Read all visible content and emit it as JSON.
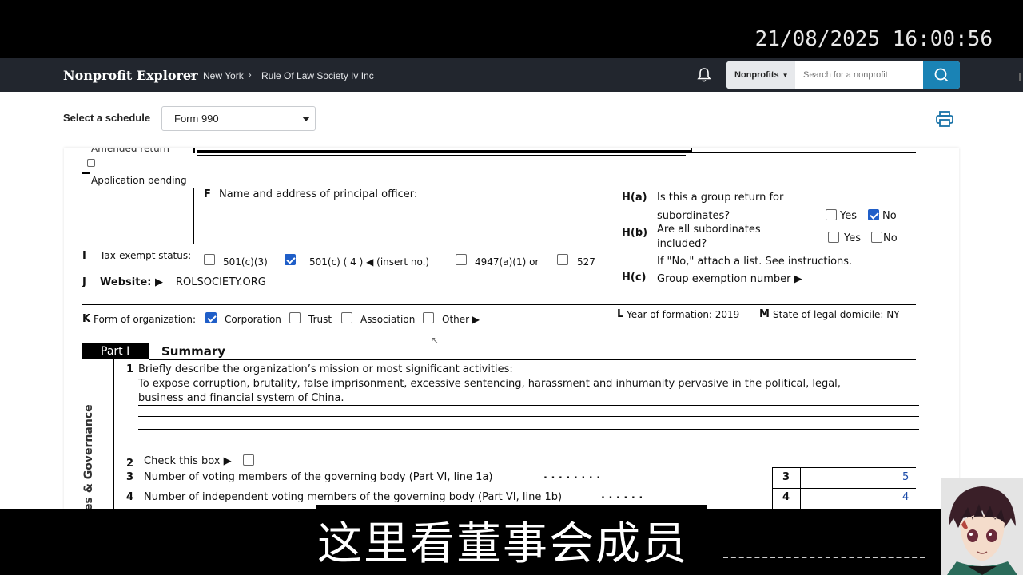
{
  "overlay": {
    "timestamp": "21/08/2025 16:00:56",
    "subtitle": "这里看董事会成员"
  },
  "nav": {
    "brand": "Nonprofit Explorer",
    "breadcrumbs": [
      "New York",
      "Rule Of Law Society Iv Inc"
    ],
    "search_category": "Nonprofits",
    "search_placeholder": "Search for a nonprofit"
  },
  "toolbar": {
    "schedule_label": "Select a schedule",
    "schedule_value": "Form 990"
  },
  "form": {
    "amended_label": "Amended return",
    "app_pending_label": "Application pending",
    "f_letter": "F",
    "f_label": "Name and address of principal officer:",
    "ha_code": "H(a)",
    "ha_q1": "Is this a group return for",
    "ha_q2": "subordinates?",
    "hb_code": "H(b)",
    "hb_q1": "Are all subordinates",
    "hb_q2": "included?",
    "hb_note": "If \"No,\" attach a list. See instructions.",
    "hc_code": "H(c)",
    "hc_label": "Group exemption number ▶",
    "yes": "Yes",
    "no": "No",
    "ha_checked": "No",
    "i_letter": "I",
    "i_label": "Tax-exempt status:",
    "i_opt1": "501(c)(3)",
    "i_opt2": "501(c) ( 4 ) ◀ (insert no.)",
    "i_opt3": "4947(a)(1) or",
    "i_opt4": "527",
    "i_checked": "501(c) ( 4 )",
    "j_letter": "J",
    "j_label": "Website: ▶",
    "j_value": "ROLSOCIETY.ORG",
    "k_letter": "K",
    "k_label": "Form of organization:",
    "k_opt1": "Corporation",
    "k_opt2": "Trust",
    "k_opt3": "Association",
    "k_opt4": "Other ▶",
    "k_checked": "Corporation",
    "l_letter": "L",
    "l_text": "Year of formation: 2019",
    "m_letter": "M",
    "m_text": "State of legal domicile: NY",
    "part_label": "Part I",
    "part_title": "Summary",
    "side_label": "es & Governance",
    "line1_num": "1",
    "line1_q": "Briefly describe the organization’s mission or most significant activities:",
    "mission_1": "To expose corruption, brutality, false imprisonment, excessive sentencing, harassment and inhumanity pervasive in the political, legal,",
    "mission_2": "business and financial system of China.",
    "line2_num": "2",
    "line2_text": "Check this box ▶",
    "line3_num": "3",
    "line3_text": "Number of voting members of the governing body (Part VI, line 1a)",
    "line3_box": "3",
    "line3_value": "5",
    "line4_num": "4",
    "line4_text": "Number of independent voting members of the governing body (Part VI, line 1b)",
    "line4_box": "4",
    "line4_value": "4",
    "dots3": ".   .   .   .   .   .   .   .",
    "dots4": ".   .   .   .   .   ."
  }
}
